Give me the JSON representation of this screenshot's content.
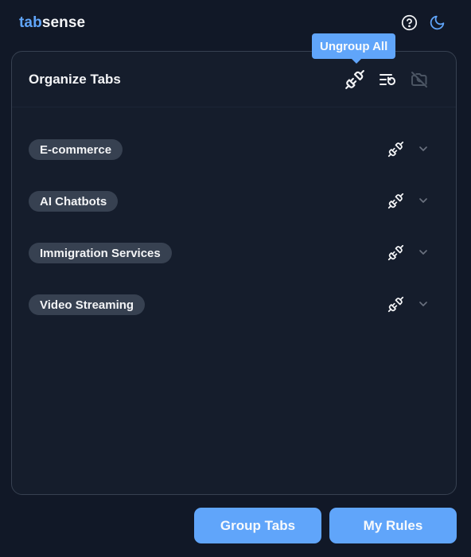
{
  "header": {
    "brand_part1": "tab",
    "brand_part2": "sense",
    "icons": [
      "help-circle-icon",
      "moon-icon"
    ]
  },
  "tooltip": {
    "text": "Ungroup All"
  },
  "card": {
    "title": "Organize Tabs",
    "actions": [
      "unlink-plug-icon",
      "sort-reset-icon",
      "camera-off-icon"
    ],
    "groups": [
      {
        "label": "E-commerce"
      },
      {
        "label": "AI Chatbots"
      },
      {
        "label": "Immigration Services"
      },
      {
        "label": "Video Streaming"
      }
    ]
  },
  "buttons": {
    "group_tabs": "Group Tabs",
    "my_rules": "My Rules"
  },
  "colors": {
    "background": "#111827",
    "accent": "#60a5fa",
    "chip": "#374151",
    "border": "#374151"
  }
}
